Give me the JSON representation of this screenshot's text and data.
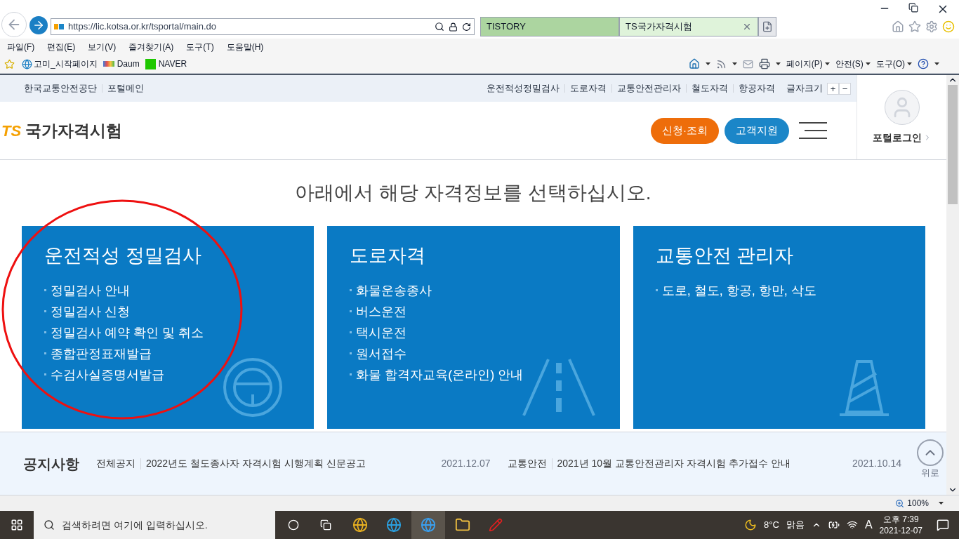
{
  "browser": {
    "address": "https://lic.kotsa.or.kr/tsportal/main.do",
    "tabs": [
      {
        "label": "TISTORY",
        "selected": false
      },
      {
        "label": "TS국가자격시험",
        "selected": true
      }
    ],
    "menu": [
      "파일(F)",
      "편집(E)",
      "보기(V)",
      "즐겨찾기(A)",
      "도구(T)",
      "도움말(H)"
    ],
    "favorites": [
      "고미_시작페이지",
      "Daum",
      "NAVER"
    ],
    "commands": [
      "페이지(P)",
      "안전(S)",
      "도구(O)"
    ],
    "zoom": "100%"
  },
  "site": {
    "top_left": [
      "한국교통안전공단",
      "포털메인"
    ],
    "top_right": [
      "운전적성정밀검사",
      "도로자격",
      "교통안전관리자",
      "철도자격",
      "항공자격"
    ],
    "font_size": {
      "label": "글자크기",
      "buttons": [
        "+",
        "−"
      ]
    },
    "logo": "TS",
    "title": "국가자격시험",
    "buttons": [
      {
        "label": "신청·조회",
        "color": "#ee6d0a"
      },
      {
        "label": "고객지원",
        "color": "#1b86c8"
      }
    ],
    "login": "포털로그인",
    "heading": "아래에서 해당 자격정보를 선택하십시오.",
    "cards": [
      {
        "title": "운전적성 정밀검사",
        "kind": "wheel",
        "items": [
          "정밀검사 안내",
          "정밀검사 신청",
          "정밀검사 예약 확인 및 취소",
          "종합판정표재발급",
          "수검사실증명서발급"
        ]
      },
      {
        "title": "도로자격",
        "kind": "road",
        "items": [
          "화물운송종사",
          "버스운전",
          "택시운전",
          "원서접수",
          "화물 합격자교육(온라인) 안내"
        ]
      },
      {
        "title": "교통안전 관리자",
        "kind": "cone",
        "items": [
          "도로, 철도, 항공, 항만, 삭도"
        ]
      }
    ],
    "notice": {
      "label": "공지사항",
      "items": [
        {
          "category": "전체공지",
          "title": "2022년도 철도종사자 자격시험 시행계획 신문공고",
          "date": "2021.12.07"
        },
        {
          "category": "교통안전",
          "title": "2021년 10월 교통안전관리자 자격시험 추가접수 안내",
          "date": "2021.10.14"
        }
      ],
      "top": "위로"
    }
  },
  "taskbar": {
    "search_placeholder": "검색하려면 여기에 입력하십시오.",
    "temperature": "8°C",
    "weather": "맑음",
    "ime": "A",
    "time": "오후 7:39",
    "date": "2021-12-07"
  }
}
